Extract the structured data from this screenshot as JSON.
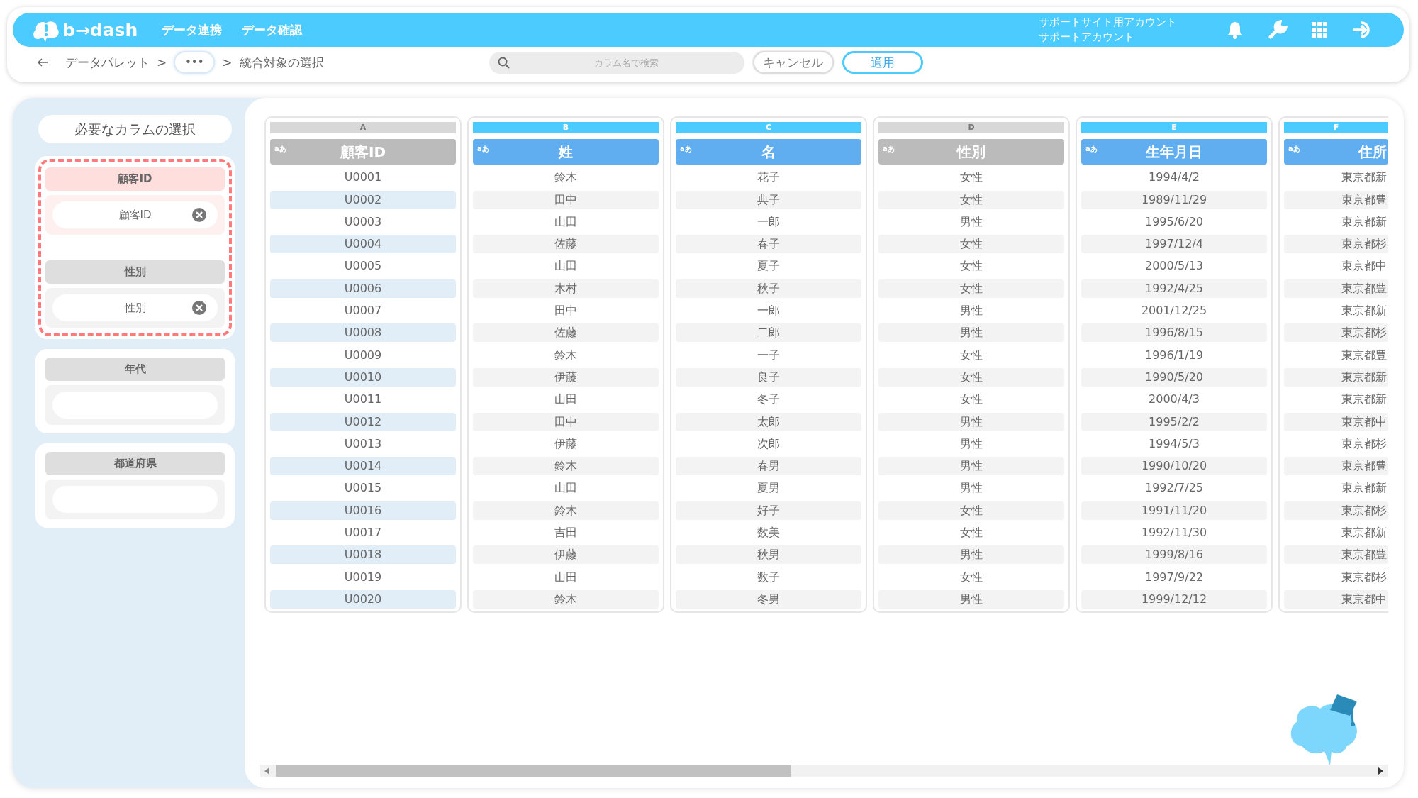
{
  "header": {
    "logo": "b→dash",
    "nav": [
      {
        "label": "データ連携"
      },
      {
        "label": "データ確認"
      }
    ],
    "account": {
      "line1": "サポートサイト用アカウント",
      "line2": "サポートアカウント"
    }
  },
  "breadcrumb": {
    "items": [
      "データパレット"
    ],
    "more": "•••",
    "current": "統合対象の選択",
    "separator": ">"
  },
  "search": {
    "placeholder": "カラム名で検索"
  },
  "buttons": [
    {
      "label": "キャンセル",
      "kind": "secondary"
    },
    {
      "label": "適用",
      "kind": "primary"
    }
  ],
  "slots_title": "必要なカラムの選択",
  "slots": [
    {
      "label": "顧客ID",
      "value": "顧客ID",
      "required": true,
      "active": true
    },
    {
      "label": "性別",
      "value": "性別",
      "required": true,
      "active": false
    },
    {
      "label": "年代",
      "required": false,
      "active": false
    },
    {
      "label": "都道府県",
      "required": false,
      "active": false
    }
  ],
  "columns": [
    {
      "letter": "A",
      "name": "顧客ID",
      "type_label": "aあ",
      "in_use": true,
      "highlighted": true,
      "cells": [
        "U0001",
        "U0002",
        "U0003",
        "U0004",
        "U0005",
        "U0006",
        "U0007",
        "U0008",
        "U0009",
        "U0010",
        "U0011",
        "U0012",
        "U0013",
        "U0014",
        "U0015",
        "U0016",
        "U0017",
        "U0018",
        "U0019",
        "U0020"
      ]
    },
    {
      "letter": "B",
      "name": "姓",
      "type_label": "aあ",
      "in_use": false,
      "highlighted": false,
      "cells": [
        "鈴木",
        "田中",
        "山田",
        "佐藤",
        "山田",
        "木村",
        "田中",
        "佐藤",
        "鈴木",
        "伊藤",
        "山田",
        "田中",
        "伊藤",
        "鈴木",
        "山田",
        "鈴木",
        "吉田",
        "伊藤",
        "山田",
        "鈴木"
      ]
    },
    {
      "letter": "C",
      "name": "名",
      "type_label": "aあ",
      "in_use": false,
      "highlighted": false,
      "cells": [
        "花子",
        "典子",
        "一郎",
        "春子",
        "夏子",
        "秋子",
        "一郎",
        "二郎",
        "一子",
        "良子",
        "冬子",
        "太郎",
        "次郎",
        "春男",
        "夏男",
        "好子",
        "数美",
        "秋男",
        "数子",
        "冬男"
      ]
    },
    {
      "letter": "D",
      "name": "性別",
      "type_label": "aあ",
      "in_use": true,
      "highlighted": false,
      "cells": [
        "女性",
        "女性",
        "男性",
        "女性",
        "女性",
        "女性",
        "男性",
        "男性",
        "女性",
        "女性",
        "女性",
        "男性",
        "男性",
        "男性",
        "男性",
        "女性",
        "女性",
        "男性",
        "女性",
        "男性"
      ]
    },
    {
      "letter": "E",
      "name": "生年月日",
      "type_label": "aあ",
      "in_use": false,
      "highlighted": false,
      "cells": [
        "1994/4/2",
        "1989/11/29",
        "1995/6/20",
        "1997/12/4",
        "2000/5/13",
        "1992/4/25",
        "2001/12/25",
        "1996/8/15",
        "1996/1/19",
        "1990/5/20",
        "2000/4/3",
        "1995/2/2",
        "1994/5/3",
        "1990/10/20",
        "1992/7/25",
        "1991/11/20",
        "1992/11/30",
        "1999/8/16",
        "1997/9/22",
        "1999/12/12"
      ]
    },
    {
      "letter": "F",
      "name": "住所",
      "type_label": "aあ",
      "in_use": false,
      "highlighted": false,
      "cells": [
        "東京都新",
        "東京都豊",
        "東京都新",
        "東京都杉",
        "東京都中",
        "東京都豊",
        "東京都新",
        "東京都杉",
        "東京都豊",
        "東京都新",
        "東京都新",
        "東京都中",
        "東京都杉",
        "東京都豊",
        "東京都新",
        "東京都杉",
        "東京都新",
        "東京都豊",
        "東京都杉",
        "東京都中"
      ]
    }
  ]
}
